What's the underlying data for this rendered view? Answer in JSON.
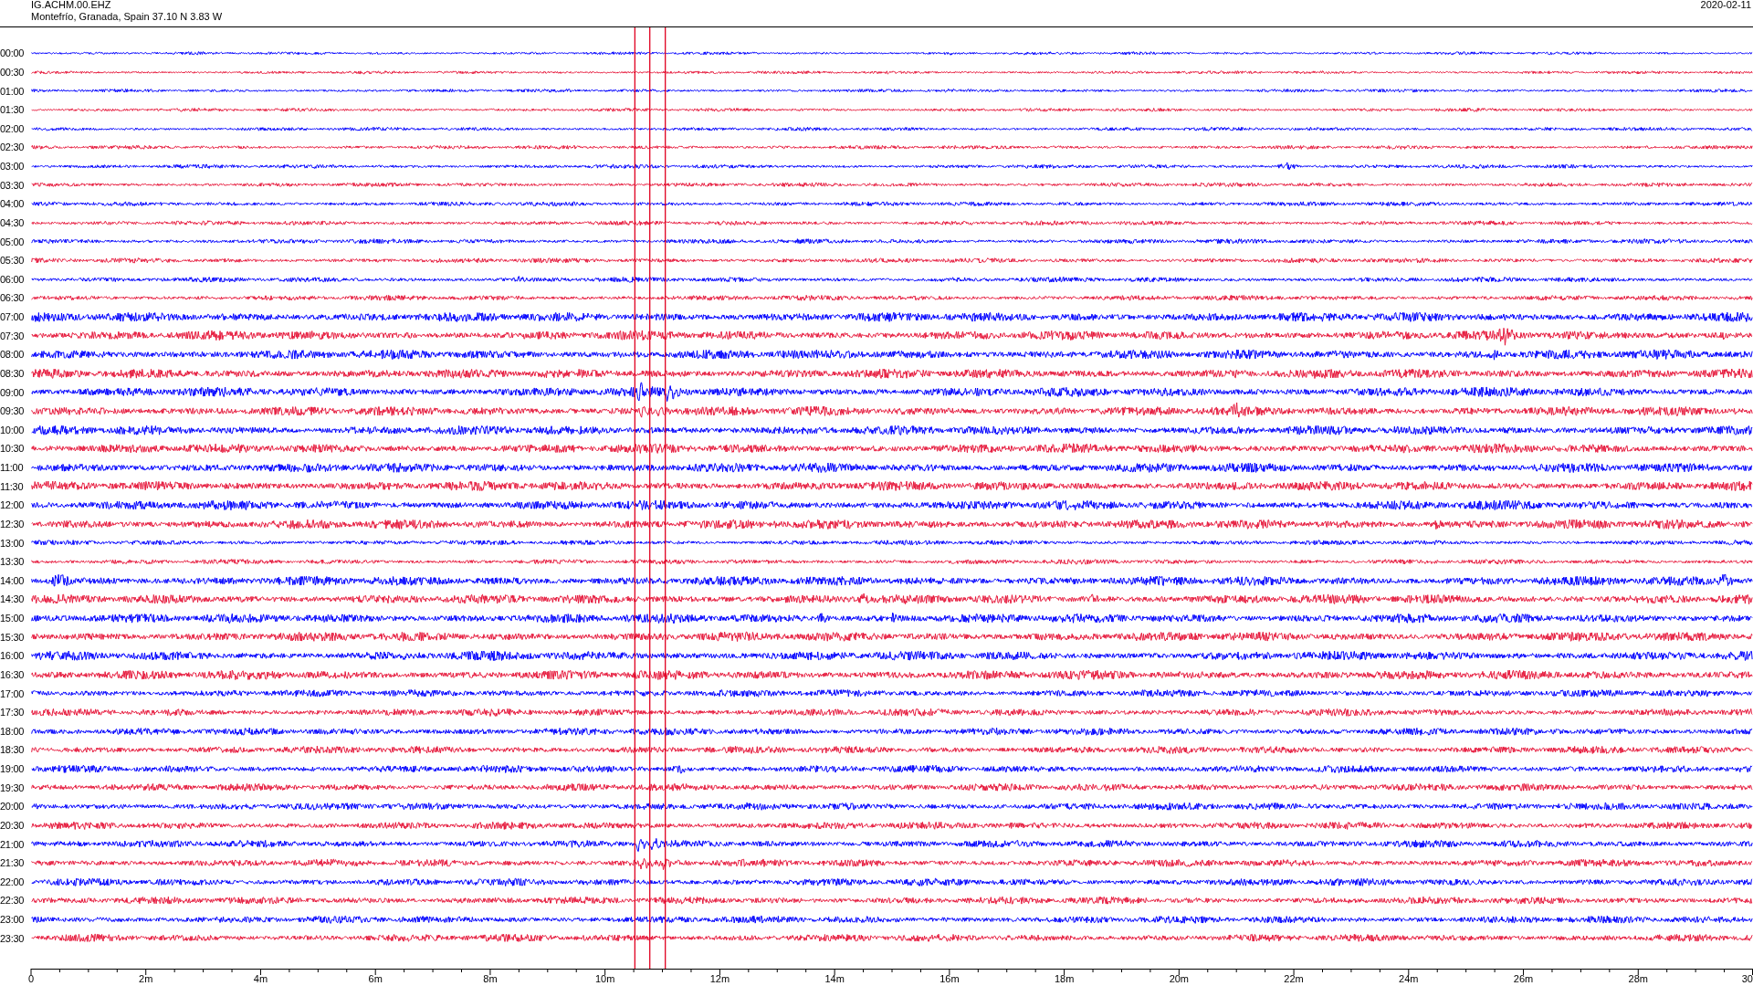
{
  "header": {
    "station": "IG.ACHM.00.EHZ",
    "location": "Montefrío, Granada, Spain  37.10 N 3.83 W",
    "date": "2020-02-11"
  },
  "rows": [
    {
      "time": "00:00",
      "color": "#0000ff"
    },
    {
      "time": "00:30",
      "color": "#e6193c"
    },
    {
      "time": "01:00",
      "color": "#0000ff"
    },
    {
      "time": "01:30",
      "color": "#e6193c"
    },
    {
      "time": "02:00",
      "color": "#0000ff"
    },
    {
      "time": "02:30",
      "color": "#e6193c"
    },
    {
      "time": "03:00",
      "color": "#0000ff"
    },
    {
      "time": "03:30",
      "color": "#e6193c"
    },
    {
      "time": "04:00",
      "color": "#0000ff"
    },
    {
      "time": "04:30",
      "color": "#e6193c"
    },
    {
      "time": "05:00",
      "color": "#0000ff"
    },
    {
      "time": "05:30",
      "color": "#e6193c"
    },
    {
      "time": "06:00",
      "color": "#0000ff"
    },
    {
      "time": "06:30",
      "color": "#e6193c"
    },
    {
      "time": "07:00",
      "color": "#0000ff"
    },
    {
      "time": "07:30",
      "color": "#e6193c"
    },
    {
      "time": "08:00",
      "color": "#0000ff"
    },
    {
      "time": "08:30",
      "color": "#e6193c"
    },
    {
      "time": "09:00",
      "color": "#0000ff"
    },
    {
      "time": "09:30",
      "color": "#e6193c"
    },
    {
      "time": "10:00",
      "color": "#0000ff"
    },
    {
      "time": "10:30",
      "color": "#e6193c"
    },
    {
      "time": "11:00",
      "color": "#0000ff"
    },
    {
      "time": "11:30",
      "color": "#e6193c"
    },
    {
      "time": "12:00",
      "color": "#0000ff"
    },
    {
      "time": "12:30",
      "color": "#e6193c"
    },
    {
      "time": "13:00",
      "color": "#0000ff"
    },
    {
      "time": "13:30",
      "color": "#e6193c"
    },
    {
      "time": "14:00",
      "color": "#0000ff"
    },
    {
      "time": "14:30",
      "color": "#e6193c"
    },
    {
      "time": "15:00",
      "color": "#0000ff"
    },
    {
      "time": "15:30",
      "color": "#e6193c"
    },
    {
      "time": "16:00",
      "color": "#0000ff"
    },
    {
      "time": "16:30",
      "color": "#e6193c"
    },
    {
      "time": "17:00",
      "color": "#0000ff"
    },
    {
      "time": "17:30",
      "color": "#e6193c"
    },
    {
      "time": "18:00",
      "color": "#0000ff"
    },
    {
      "time": "18:30",
      "color": "#e6193c"
    },
    {
      "time": "19:00",
      "color": "#0000ff"
    },
    {
      "time": "19:30",
      "color": "#e6193c"
    },
    {
      "time": "20:00",
      "color": "#0000ff"
    },
    {
      "time": "20:30",
      "color": "#e6193c"
    },
    {
      "time": "21:00",
      "color": "#0000ff"
    },
    {
      "time": "21:30",
      "color": "#e6193c"
    },
    {
      "time": "22:00",
      "color": "#0000ff"
    },
    {
      "time": "22:30",
      "color": "#e6193c"
    },
    {
      "time": "23:00",
      "color": "#0000ff"
    },
    {
      "time": "23:30",
      "color": "#e6193c"
    }
  ],
  "x_axis": {
    "labels": [
      "0",
      "2m",
      "4m",
      "6m",
      "8m",
      "10m",
      "12m",
      "14m",
      "16m",
      "18m",
      "20m",
      "22m",
      "24m",
      "26m",
      "28m",
      "30"
    ]
  }
}
